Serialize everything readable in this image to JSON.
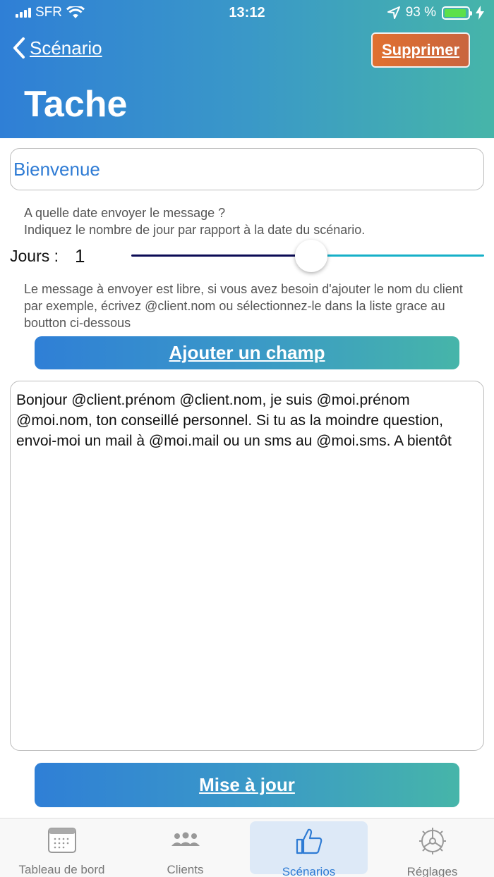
{
  "status_bar": {
    "carrier": "SFR",
    "time": "13:12",
    "battery_percent": "93 %",
    "battery_level": 0.93
  },
  "nav": {
    "back_label": "Scénario",
    "delete_label": "Supprimer",
    "title": "Tache"
  },
  "form": {
    "task_name": "Bienvenue",
    "date_help": "A quelle date envoyer le message ?\nIndiquez le nombre de jour par rapport à la date du scénario.",
    "days_label": "Jours :",
    "days_value": "1",
    "days_slider_fraction": 0.51,
    "message_help": "Le message à envoyer est libre, si vous avez besoin d'ajouter le nom du client par exemple, écrivez @client.nom ou sélectionnez-le dans la liste grace au boutton ci-dessous",
    "add_field_label": "Ajouter un champ",
    "message_body": "Bonjour @client.prénom @client.nom, je suis @moi.prénom @moi.nom, ton conseillé personnel. Si tu as la moindre question, envoi-moi un mail à @moi.mail ou un sms au @moi.sms. A bientôt",
    "update_label": "Mise à jour"
  },
  "tabs": [
    {
      "label": "Tableau de bord",
      "icon": "calendar-icon",
      "active": false
    },
    {
      "label": "Clients",
      "icon": "people-icon",
      "active": false
    },
    {
      "label": "Scénarios",
      "icon": "thumbs-up-icon",
      "active": true
    },
    {
      "label": "Réglages",
      "icon": "gear-icon",
      "active": false
    }
  ],
  "colors": {
    "header_gradient_start": "#2f7fd6",
    "header_gradient_end": "#46b5a9",
    "delete_button": "#d96a35",
    "accent_blue": "#2e7bd4"
  }
}
